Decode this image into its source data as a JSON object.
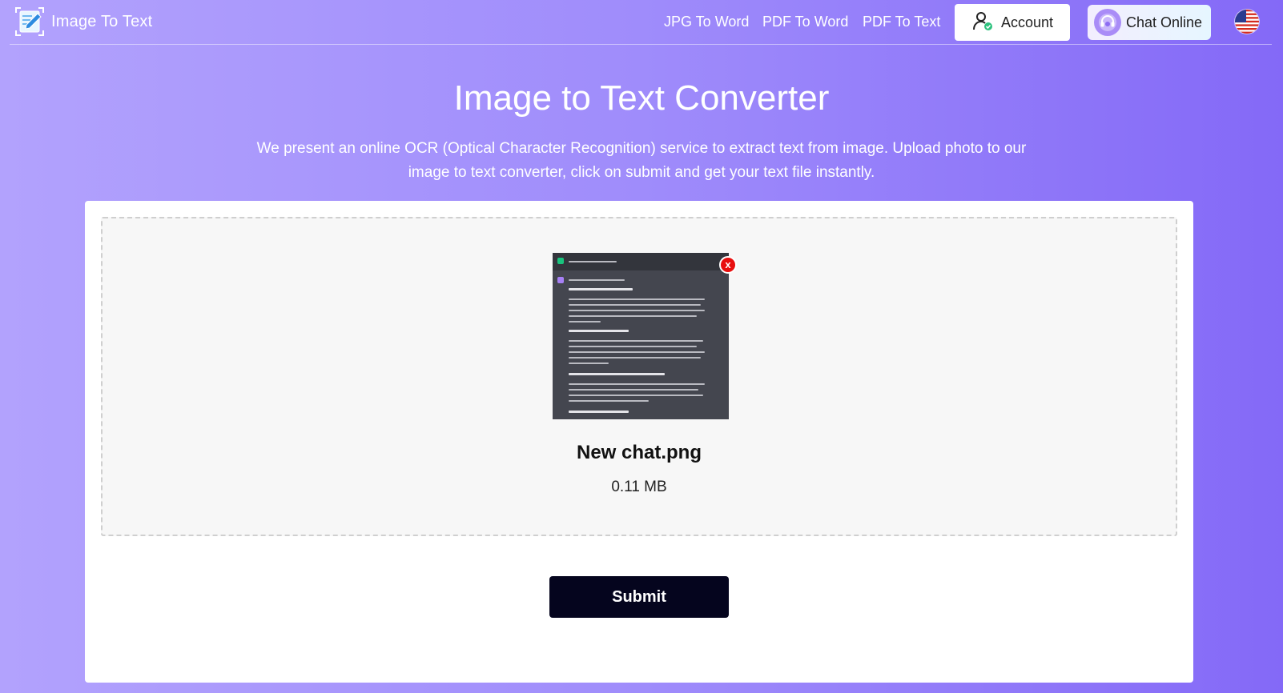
{
  "brand": {
    "name": "Image To Text",
    "logo_icon": "notepad-pen-icon"
  },
  "nav": {
    "links": [
      {
        "label": "JPG To Word"
      },
      {
        "label": "PDF To Word"
      },
      {
        "label": "PDF To Text"
      }
    ],
    "account_label": "Account",
    "account_icon": "user-check-icon",
    "chat_label": "Chat Online",
    "chat_icon": "headset-icon",
    "language_icon": "us-flag-icon"
  },
  "hero": {
    "title": "Image to Text Converter",
    "description": "We present an online OCR (Optical Character Recognition) service to extract text from image. Upload photo to our image to text converter, click on submit and get your text file instantly."
  },
  "upload": {
    "file_name": "New chat.png",
    "file_size": "0.11 MB",
    "remove_label": "x",
    "submit_label": "Submit"
  },
  "colors": {
    "gradient_start": "#b2a2fd",
    "gradient_end": "#8469f7",
    "submit_bg": "#05051e",
    "remove_bg": "#e80f0f"
  }
}
